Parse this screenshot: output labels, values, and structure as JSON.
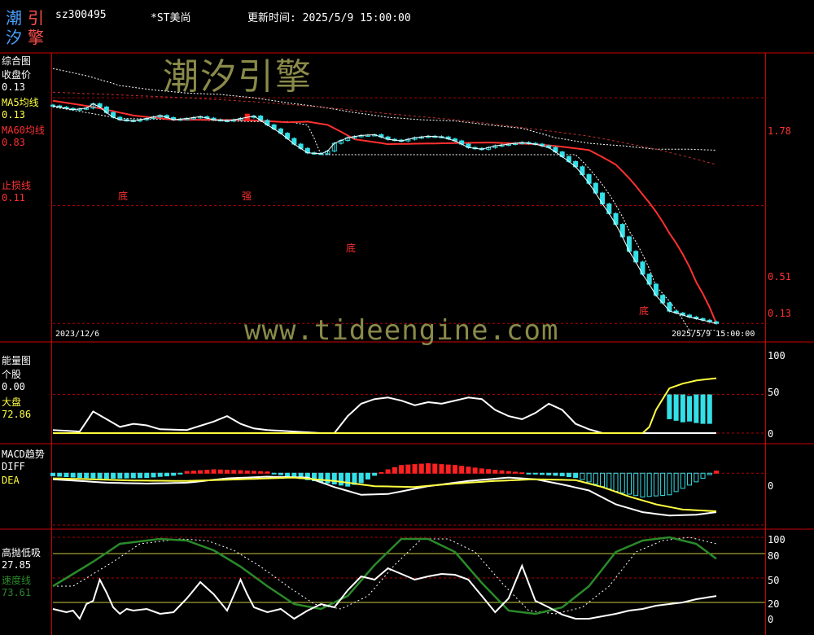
{
  "header": {
    "logo_chars": [
      "潮",
      "引",
      "汐",
      "擎"
    ],
    "code": "sz300495",
    "name": "*ST美尚",
    "update_time": "更新时间: 2025/5/9 15:00:00"
  },
  "watermarks": {
    "brand": "潮汐引擎",
    "url": "www.tideengine.com"
  },
  "colors": {
    "bg": "#000000",
    "frame": "#cc0000",
    "grid": "#aa0000",
    "up": "#ff2020",
    "down": "#33e0e8",
    "ma5": "#ffffff",
    "ma60": "#ff3030",
    "ma60_dash": "#c03030",
    "yellow": "#ffff40",
    "green": "#2a8a2a",
    "watermark": "#8a8a4a"
  },
  "panels": {
    "main": {
      "title": "综合图",
      "legend": [
        {
          "label": "收盘价",
          "value": "0.13",
          "label_color": "#ffffff"
        },
        {
          "label": "MA5均线",
          "value": "0.13",
          "label_color": "#ffff40"
        },
        {
          "label": "MA60均线",
          "value": "0.83",
          "label_color": "#ff3030"
        },
        {
          "label": "止损线",
          "value": "0.11",
          "label_color": "#ff3030"
        }
      ],
      "date_start": "2023/12/6",
      "date_end": "2025/5/9  15:00:00",
      "y_ticks": [
        "1.78",
        "0.51",
        "0.13"
      ],
      "annotations": [
        "底",
        "强",
        "底",
        "底"
      ]
    },
    "energy": {
      "title": "能量图",
      "legend": [
        {
          "label": "个股",
          "value": "0.00",
          "label_color": "#ffffff"
        },
        {
          "label": "大盘",
          "value": "72.86",
          "label_color": "#ffff40"
        }
      ],
      "y_ticks": [
        "100",
        "50",
        "0"
      ]
    },
    "macd": {
      "title": "MACD趋势",
      "legend": [
        {
          "label": "DIFF",
          "value": "",
          "label_color": "#ffffff"
        },
        {
          "label": "DEA",
          "value": "",
          "label_color": "#ffff40"
        }
      ],
      "y_ticks": [
        "0"
      ]
    },
    "osc": {
      "title": "高抛低吸",
      "legend": [
        {
          "label": "",
          "value": "27.85",
          "label_color": "#ffffff"
        },
        {
          "label": "速度线",
          "value": "73.61",
          "label_color": "#2a8a2a"
        }
      ],
      "y_ticks": [
        "100",
        "80",
        "50",
        "20",
        "0"
      ]
    }
  },
  "chart_data": [
    {
      "type": "line",
      "name": "main",
      "x_range": [
        "2023/12/6",
        "2025/5/9"
      ],
      "n": 100,
      "y_ticks": [
        1.78,
        0.51,
        0.13
      ],
      "ma60_key_x": [
        0,
        6,
        12,
        18,
        24,
        30,
        35,
        38,
        41,
        45,
        50,
        58,
        65,
        72,
        76,
        80,
        84,
        88,
        92,
        96,
        99
      ],
      "ma60_key_y": [
        1.72,
        1.6,
        1.45,
        1.38,
        1.38,
        1.37,
        1.34,
        1.35,
        1.3,
        1.1,
        1.04,
        1.05,
        1.06,
        1.04,
        1.01,
        0.97,
        0.82,
        0.58,
        0.37,
        0.21,
        0.13
      ],
      "band_upper_key_x": [
        0,
        5,
        10,
        15,
        20,
        25,
        30,
        35,
        40,
        45,
        50,
        55,
        60,
        65,
        70,
        75,
        80,
        85,
        90,
        95,
        99
      ],
      "band_upper_key_y": [
        2.5,
        2.3,
        2.05,
        1.95,
        1.88,
        1.85,
        1.78,
        1.68,
        1.6,
        1.5,
        1.42,
        1.38,
        1.36,
        1.3,
        1.25,
        1.12,
        1.05,
        1.02,
        0.98,
        0.98,
        0.97
      ],
      "band_lower_key_x": [
        0,
        10,
        20,
        30,
        35,
        38,
        40,
        45,
        50,
        58,
        65,
        72,
        78,
        82,
        86,
        90,
        95,
        99
      ],
      "band_lower_key_y": [
        1.6,
        1.4,
        1.38,
        1.35,
        1.35,
        1.3,
        0.92,
        0.92,
        0.92,
        0.92,
        0.92,
        0.92,
        0.92,
        0.65,
        0.38,
        0.2,
        0.12,
        0.12
      ],
      "ma60_dash_key_x": [
        0,
        10,
        20,
        30,
        40,
        50,
        60,
        70,
        80,
        90,
        99
      ],
      "ma60_dash_key_y": [
        1.9,
        1.84,
        1.78,
        1.7,
        1.6,
        1.48,
        1.38,
        1.26,
        1.14,
        0.98,
        0.82
      ],
      "price_key_x": [
        0,
        3,
        5,
        6,
        7,
        8,
        9,
        10,
        12,
        14,
        16,
        18,
        20,
        22,
        24,
        26,
        28,
        30,
        32,
        34,
        36,
        38,
        40,
        41,
        42,
        44,
        46,
        48,
        50,
        52,
        54,
        56,
        58,
        60,
        62,
        64,
        66,
        68,
        70,
        72,
        74,
        76,
        78,
        80,
        82,
        84,
        86,
        88,
        90,
        92,
        95,
        99
      ],
      "price_key_y": [
        1.62,
        1.55,
        1.58,
        1.66,
        1.6,
        1.5,
        1.42,
        1.38,
        1.36,
        1.4,
        1.45,
        1.38,
        1.4,
        1.43,
        1.38,
        1.36,
        1.4,
        1.44,
        1.3,
        1.18,
        1.04,
        0.94,
        0.93,
        0.96,
        1.05,
        1.12,
        1.15,
        1.16,
        1.1,
        1.08,
        1.12,
        1.14,
        1.13,
        1.08,
        1.0,
        0.98,
        1.02,
        1.04,
        1.06,
        1.04,
        1.0,
        0.9,
        0.8,
        0.66,
        0.52,
        0.41,
        0.3,
        0.23,
        0.18,
        0.15,
        0.14,
        0.13
      ]
    },
    {
      "type": "line",
      "name": "energy",
      "ylim": [
        0,
        100
      ],
      "stock_key_x": [
        0,
        4,
        6,
        8,
        10,
        12,
        14,
        16,
        20,
        24,
        26,
        28,
        30,
        32,
        36,
        40,
        42,
        44,
        46,
        48,
        50,
        52,
        54,
        56,
        58,
        60,
        62,
        64,
        66,
        68,
        70,
        72,
        74,
        76,
        78,
        80,
        82,
        84,
        88,
        90,
        92,
        94,
        96,
        99
      ],
      "stock_key_y": [
        4,
        2,
        28,
        18,
        8,
        12,
        10,
        5,
        4,
        15,
        22,
        12,
        6,
        4,
        2,
        0,
        0,
        22,
        38,
        44,
        46,
        42,
        36,
        40,
        38,
        42,
        46,
        44,
        30,
        22,
        18,
        26,
        38,
        30,
        12,
        5,
        0,
        0,
        0,
        0,
        0,
        0,
        0,
        0
      ],
      "market_key_x": [
        0,
        88,
        89,
        90,
        92,
        94,
        96,
        98,
        99
      ],
      "market_key_y": [
        0,
        0,
        8,
        30,
        58,
        64,
        68,
        70,
        71
      ],
      "bars_x": [
        92,
        93,
        94,
        95,
        96,
        97,
        98
      ],
      "bars_top": [
        50,
        50,
        50,
        48,
        50,
        50,
        50
      ],
      "bars_bottom": [
        18,
        16,
        14,
        15,
        13,
        12,
        12
      ]
    },
    {
      "type": "bar",
      "name": "macd",
      "diff_key_x": [
        0,
        4,
        8,
        14,
        20,
        26,
        32,
        38,
        42,
        46,
        50,
        56,
        62,
        68,
        72,
        76,
        80,
        84,
        88,
        92,
        96,
        99
      ],
      "diff_key_y": [
        -0.14,
        -0.18,
        -0.22,
        -0.24,
        -0.22,
        -0.12,
        -0.08,
        -0.1,
        -0.32,
        -0.5,
        -0.48,
        -0.3,
        -0.18,
        -0.1,
        -0.14,
        -0.26,
        -0.4,
        -0.72,
        -0.9,
        -0.98,
        -0.96,
        -0.9
      ],
      "dea_key_x": [
        0,
        6,
        12,
        20,
        28,
        36,
        42,
        48,
        54,
        60,
        66,
        72,
        78,
        82,
        86,
        90,
        94,
        99
      ],
      "dea_key_y": [
        -0.12,
        -0.14,
        -0.17,
        -0.18,
        -0.14,
        -0.1,
        -0.18,
        -0.3,
        -0.32,
        -0.24,
        -0.18,
        -0.14,
        -0.16,
        -0.32,
        -0.54,
        -0.72,
        -0.84,
        -0.88
      ],
      "hist_key_x": [
        0,
        4,
        8,
        14,
        18,
        20,
        24,
        28,
        32,
        36,
        40,
        44,
        46,
        48,
        50,
        52,
        56,
        60,
        64,
        68,
        72,
        74,
        76,
        78,
        80,
        84,
        88,
        92,
        96,
        99
      ],
      "hist_key_y": [
        -0.06,
        -0.1,
        -0.12,
        -0.1,
        -0.05,
        0.04,
        0.08,
        0.06,
        0.03,
        -0.1,
        -0.2,
        -0.3,
        -0.22,
        -0.05,
        0.08,
        0.18,
        0.22,
        0.18,
        0.1,
        0.04,
        -0.02,
        -0.04,
        -0.06,
        -0.1,
        -0.2,
        -0.42,
        -0.55,
        -0.5,
        -0.2,
        0.05
      ],
      "ylim": [
        -1.2,
        0.4
      ]
    },
    {
      "type": "line",
      "name": "osc",
      "ylim": [
        0,
        100
      ],
      "white_key_x": [
        0,
        2,
        3,
        4,
        5,
        6,
        7,
        8,
        9,
        10,
        11,
        12,
        14,
        16,
        18,
        20,
        22,
        24,
        26,
        28,
        29,
        30,
        32,
        34,
        36,
        38,
        40,
        42,
        44,
        46,
        48,
        50,
        52,
        54,
        56,
        58,
        60,
        62,
        64,
        66,
        68,
        70,
        72,
        74,
        76,
        78,
        80,
        82,
        84,
        86,
        88,
        90,
        92,
        94,
        96,
        99
      ],
      "white_key_y": [
        12,
        8,
        10,
        0,
        18,
        22,
        48,
        32,
        14,
        6,
        12,
        10,
        12,
        6,
        8,
        25,
        45,
        30,
        10,
        48,
        30,
        14,
        8,
        12,
        0,
        10,
        18,
        14,
        35,
        52,
        48,
        62,
        55,
        48,
        52,
        55,
        54,
        48,
        28,
        8,
        25,
        65,
        22,
        14,
        5,
        0,
        0,
        3,
        6,
        10,
        12,
        16,
        18,
        20,
        24,
        27.85
      ],
      "green_key_x": [
        0,
        6,
        10,
        16,
        20,
        24,
        28,
        32,
        36,
        40,
        44,
        48,
        52,
        56,
        60,
        64,
        68,
        72,
        76,
        80,
        84,
        88,
        92,
        96,
        99
      ],
      "green_key_y": [
        40,
        70,
        92,
        98,
        96,
        84,
        64,
        40,
        18,
        12,
        28,
        66,
        98,
        98,
        82,
        44,
        10,
        6,
        14,
        40,
        82,
        96,
        100,
        92,
        73.61
      ]
    }
  ]
}
